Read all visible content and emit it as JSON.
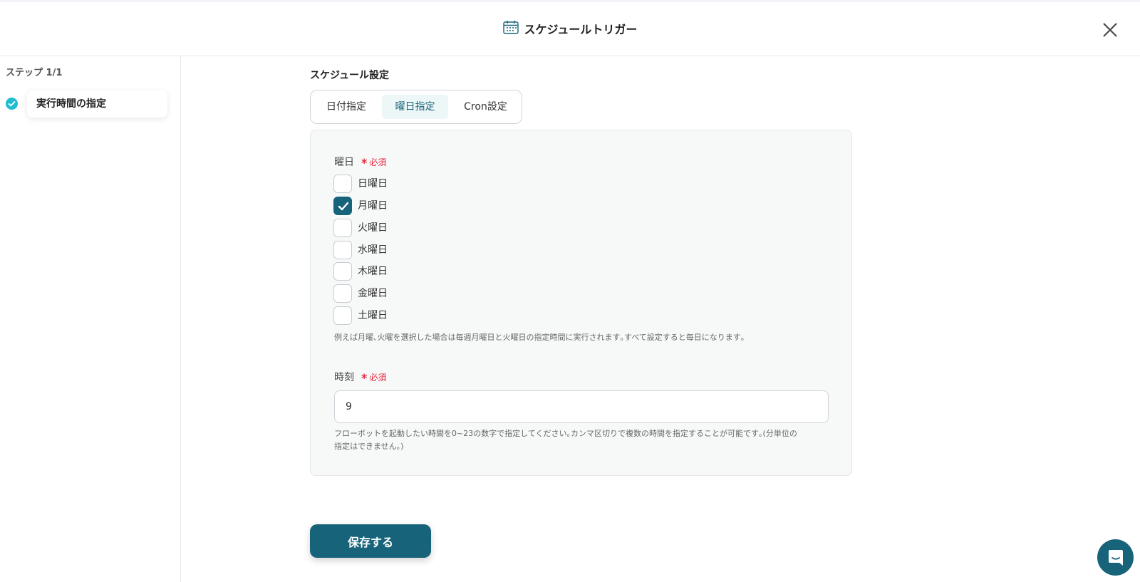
{
  "header": {
    "title": "スケジュールトリガー",
    "icon": "calendar-icon",
    "close_icon": "close-icon"
  },
  "sidebar": {
    "step_count": "ステップ 1/1",
    "steps": [
      {
        "label": "実行時間の指定",
        "status": "completed"
      }
    ]
  },
  "main": {
    "section_title": "スケジュール設定",
    "tabs": [
      {
        "label": "日付指定",
        "active": false
      },
      {
        "label": "曜日指定",
        "active": true
      },
      {
        "label": "Cron設定",
        "active": false
      }
    ],
    "weekday_field": {
      "label": "曜日",
      "required_label": "必須",
      "options": [
        {
          "label": "日曜日",
          "checked": false
        },
        {
          "label": "月曜日",
          "checked": true
        },
        {
          "label": "火曜日",
          "checked": false
        },
        {
          "label": "水曜日",
          "checked": false
        },
        {
          "label": "木曜日",
          "checked": false
        },
        {
          "label": "金曜日",
          "checked": false
        },
        {
          "label": "土曜日",
          "checked": false
        }
      ],
      "help": "例えば月曜､火曜を選択した場合は毎週月曜日と火曜日の指定時間に実行されます｡すべて設定すると毎日になります｡"
    },
    "time_field": {
      "label": "時刻",
      "required_label": "必須",
      "value": "9",
      "help_line1": "フローボットを起動したい時間を0~23の数字で指定してください｡カンマ区切りで複数の時間を指定することが可能です｡(分単位の",
      "help_line2": "指定はできません｡)"
    },
    "save_label": "保存する"
  },
  "colors": {
    "primary": "#17637a",
    "required": "#e3293e",
    "step_check": "#1fbcd2"
  }
}
